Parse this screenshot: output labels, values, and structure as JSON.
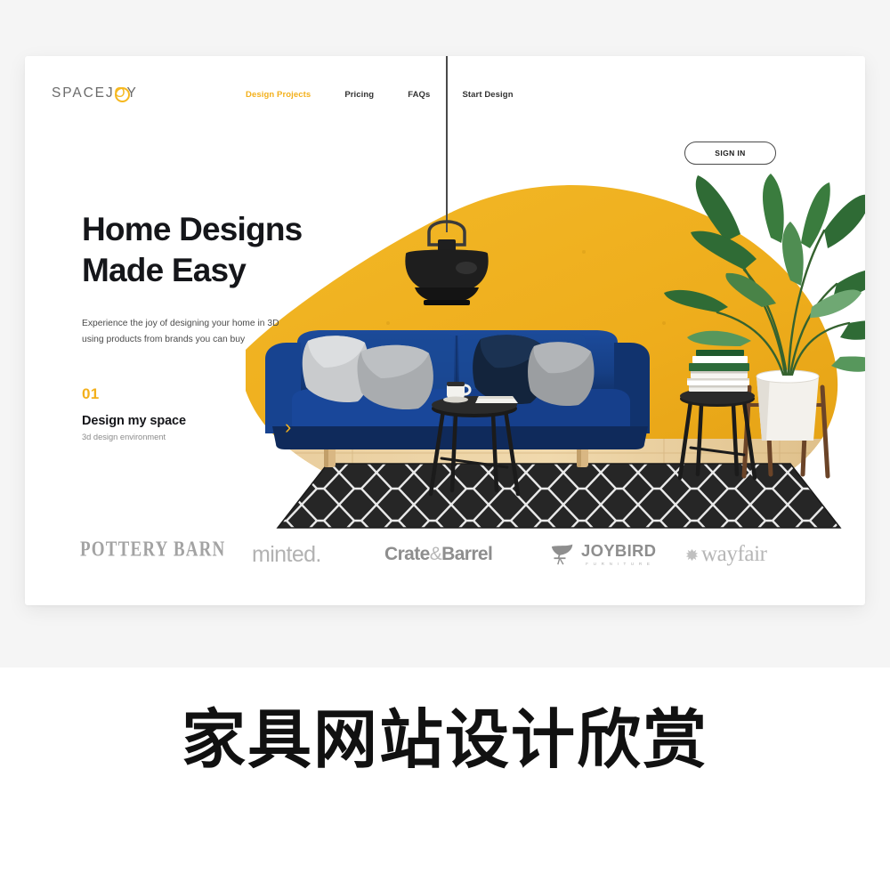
{
  "page": {
    "background_top": "#f5f5f5",
    "background_bottom": "#ffffff",
    "accent_color": "#f3b01c",
    "caption": "家具网站设计欣赏"
  },
  "card": {
    "background": "#ffffff"
  },
  "nav": {
    "logo": {
      "text_before": "SPACEJ",
      "highlight_letter": "O",
      "text_after": "Y",
      "full_text": "SPACEJOY"
    },
    "links": [
      {
        "label": "Design Projects",
        "active": true
      },
      {
        "label": "Pricing",
        "active": false
      },
      {
        "label": "FAQs",
        "active": false
      },
      {
        "label": "Start Design",
        "active": false
      }
    ],
    "sign_in_label": "SIGN IN"
  },
  "hero": {
    "headline_line1": "Home Designs",
    "headline_line2": "Made Easy",
    "subcopy_line1": "Experience the joy of designing your home in 3D",
    "subcopy_line2": "using products from brands you can buy",
    "cta": {
      "number": "01",
      "title": "Design my space",
      "subtitle": "3d design environment",
      "arrow": "›"
    },
    "artwork": {
      "blob_color": "#efb01e",
      "sofa_color": "#143a7e",
      "lamp_color": "#1d1d1d",
      "rug_color": "#2b2b2b",
      "floor_color": "#e7c893",
      "plant_color": "#2e6b3a",
      "planter_color": "#f2f0ec"
    }
  },
  "brands": [
    {
      "name": "POTTERY BARN"
    },
    {
      "name": "minted."
    },
    {
      "name": "Crate",
      "amp": "&",
      "name2": "Barrel"
    },
    {
      "name": "JOYBIRD",
      "sub": "F U R N I T U R E"
    },
    {
      "name": "wayfair"
    }
  ]
}
